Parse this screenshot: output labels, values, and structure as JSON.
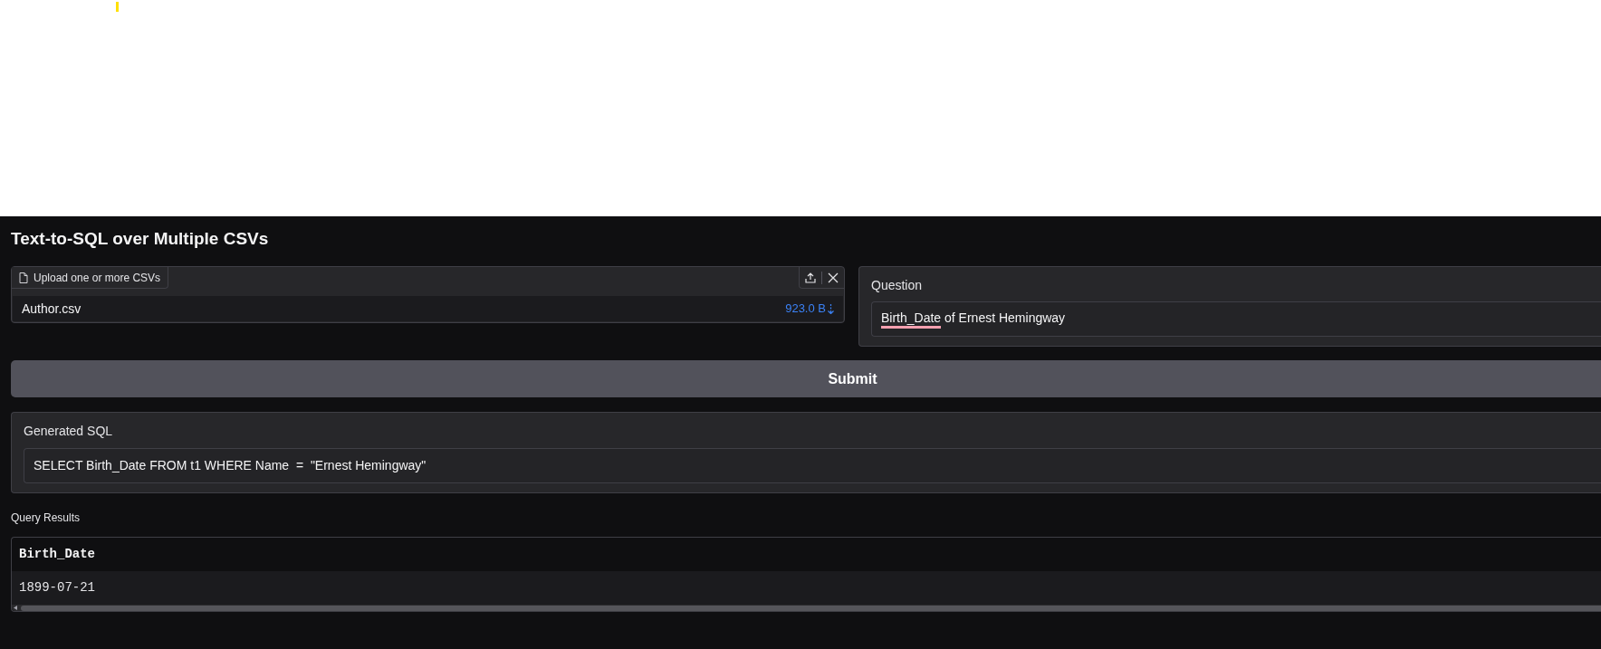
{
  "title": "Text-to-SQL over Multiple CSVs",
  "upload": {
    "label": "Upload one or more CSVs",
    "files": [
      {
        "name": "Author.csv",
        "size": "923.0 B"
      }
    ]
  },
  "question": {
    "label": "Question",
    "value_segments": [
      {
        "text": "Birth_Date",
        "misspelled": true
      },
      {
        "text": "of Ernest Hemingway",
        "misspelled": false
      }
    ]
  },
  "submit_button": {
    "label": "Submit"
  },
  "generated_sql": {
    "label": "Generated SQL",
    "value": "SELECT Birth_Date FROM t1 WHERE Name  =  \"Ernest Hemingway\""
  },
  "query_results": {
    "label": "Query Results",
    "columns": [
      "Birth_Date"
    ],
    "rows": [
      [
        "1899-07-21"
      ]
    ]
  }
}
